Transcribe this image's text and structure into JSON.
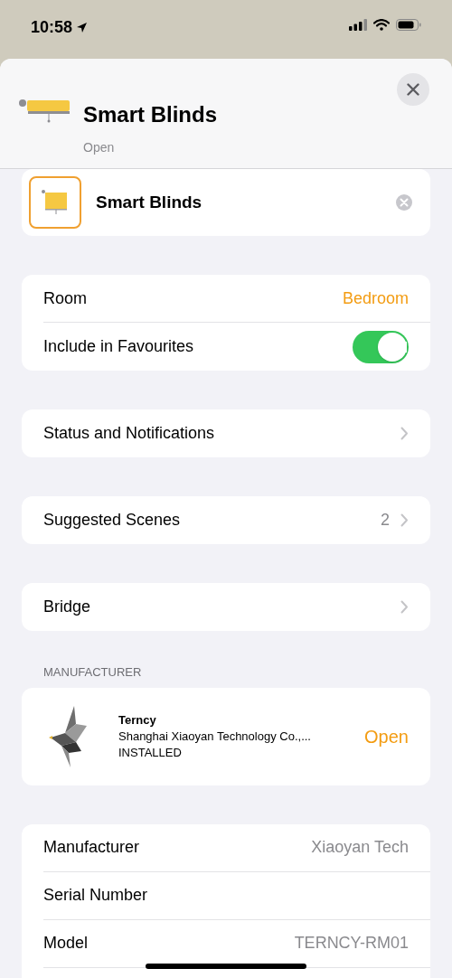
{
  "status_bar": {
    "time": "10:58"
  },
  "header": {
    "title": "Smart Blinds",
    "subtitle": "Open"
  },
  "name_field": {
    "value": "Smart Blinds"
  },
  "groups": [
    {
      "rows": [
        {
          "kind": "value",
          "label": "Room",
          "value": "Bedroom"
        },
        {
          "kind": "toggle",
          "label": "Include in Favourites",
          "on": true
        }
      ]
    },
    {
      "rows": [
        {
          "kind": "link",
          "label": "Status and Notifications"
        }
      ]
    },
    {
      "rows": [
        {
          "kind": "link",
          "label": "Suggested Scenes",
          "value": "2"
        }
      ]
    },
    {
      "rows": [
        {
          "kind": "link",
          "label": "Bridge"
        }
      ]
    }
  ],
  "manufacturer_section": {
    "heading": "MANUFACTURER",
    "app": {
      "name": "Terncy",
      "developer": "Shanghai Xiaoyan Technology Co.,...",
      "status": "INSTALLED",
      "action": "Open"
    }
  },
  "info": {
    "rows": [
      {
        "label": "Manufacturer",
        "value": "Xiaoyan Tech"
      },
      {
        "label": "Serial Number"
      },
      {
        "label": "Model",
        "value": "TERNCY-RM01"
      }
    ]
  }
}
